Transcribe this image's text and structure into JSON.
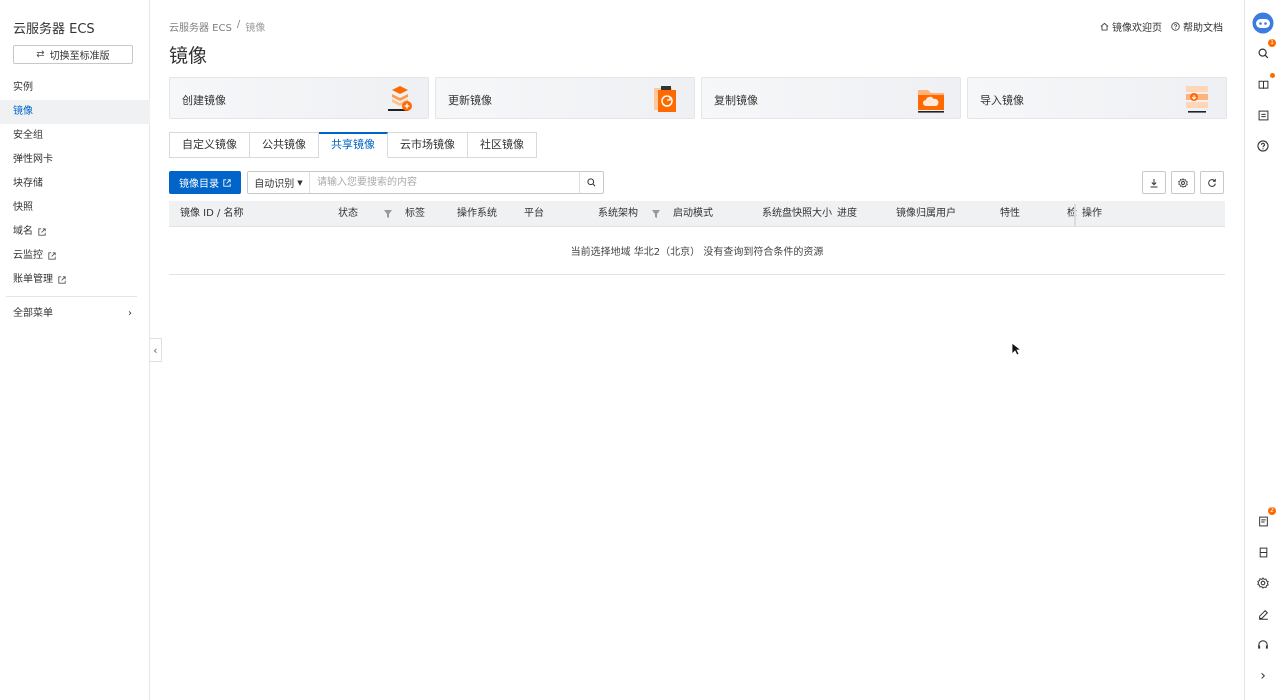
{
  "sidebar": {
    "title": "云服务器 ECS",
    "switch_label": "切换至标准版",
    "items": [
      {
        "label": "实例"
      },
      {
        "label": "镜像"
      },
      {
        "label": "安全组"
      },
      {
        "label": "弹性网卡"
      },
      {
        "label": "块存储"
      },
      {
        "label": "快照"
      },
      {
        "label": "域名"
      },
      {
        "label": "云监控"
      },
      {
        "label": "账单管理"
      }
    ],
    "all_menu_label": "全部菜单"
  },
  "header": {
    "breadcrumb": [
      "云服务器 ECS",
      "镜像"
    ],
    "links": {
      "welcome": "镜像欢迎页",
      "help": "帮助文档"
    },
    "title": "镜像"
  },
  "cards": [
    {
      "label": "创建镜像",
      "icon": "create-image-icon"
    },
    {
      "label": "更新镜像",
      "icon": "update-image-icon"
    },
    {
      "label": "复制镜像",
      "icon": "copy-image-icon"
    },
    {
      "label": "导入镜像",
      "icon": "import-image-icon"
    }
  ],
  "tabs": [
    {
      "label": "自定义镜像"
    },
    {
      "label": "公共镜像"
    },
    {
      "label": "共享镜像"
    },
    {
      "label": "云市场镜像"
    },
    {
      "label": "社区镜像"
    }
  ],
  "toolbar": {
    "catalog_button": "镜像目录",
    "search_type": "自动识别",
    "search_placeholder": "请输入您要搜索的内容"
  },
  "table": {
    "columns": [
      "镜像 ID / 名称",
      "状态",
      "标签",
      "操作系统",
      "平台",
      "系统架构",
      "启动模式",
      "系统盘快照大小",
      "进度",
      "镜像归属用户",
      "特性",
      "检",
      "操作"
    ],
    "empty_message": "当前选择地域 华北2（北京） 没有查询到符合条件的资源"
  },
  "rail": {
    "badges": {
      "search": "1",
      "orders": "2"
    }
  },
  "colors": {
    "accent": "#0064c8",
    "badge": "#ff6a00",
    "card_art": "#ff6a00"
  }
}
